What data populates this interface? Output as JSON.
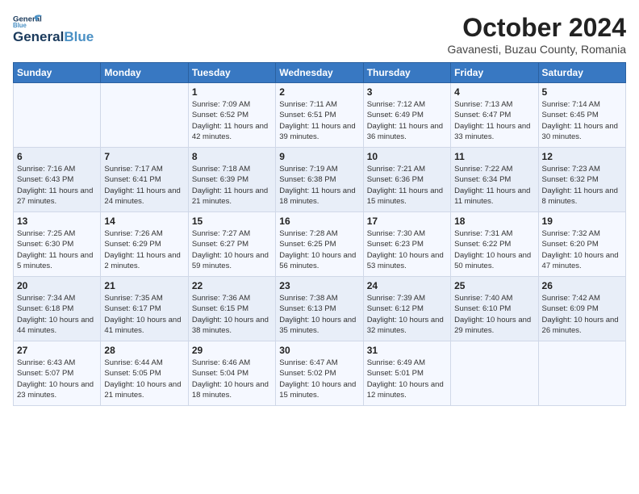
{
  "header": {
    "logo_line1": "General",
    "logo_line2": "Blue",
    "month": "October 2024",
    "location": "Gavanesti, Buzau County, Romania"
  },
  "weekdays": [
    "Sunday",
    "Monday",
    "Tuesday",
    "Wednesday",
    "Thursday",
    "Friday",
    "Saturday"
  ],
  "weeks": [
    [
      {
        "day": "",
        "info": ""
      },
      {
        "day": "",
        "info": ""
      },
      {
        "day": "1",
        "info": "Sunrise: 7:09 AM\nSunset: 6:52 PM\nDaylight: 11 hours and 42 minutes."
      },
      {
        "day": "2",
        "info": "Sunrise: 7:11 AM\nSunset: 6:51 PM\nDaylight: 11 hours and 39 minutes."
      },
      {
        "day": "3",
        "info": "Sunrise: 7:12 AM\nSunset: 6:49 PM\nDaylight: 11 hours and 36 minutes."
      },
      {
        "day": "4",
        "info": "Sunrise: 7:13 AM\nSunset: 6:47 PM\nDaylight: 11 hours and 33 minutes."
      },
      {
        "day": "5",
        "info": "Sunrise: 7:14 AM\nSunset: 6:45 PM\nDaylight: 11 hours and 30 minutes."
      }
    ],
    [
      {
        "day": "6",
        "info": "Sunrise: 7:16 AM\nSunset: 6:43 PM\nDaylight: 11 hours and 27 minutes."
      },
      {
        "day": "7",
        "info": "Sunrise: 7:17 AM\nSunset: 6:41 PM\nDaylight: 11 hours and 24 minutes."
      },
      {
        "day": "8",
        "info": "Sunrise: 7:18 AM\nSunset: 6:39 PM\nDaylight: 11 hours and 21 minutes."
      },
      {
        "day": "9",
        "info": "Sunrise: 7:19 AM\nSunset: 6:38 PM\nDaylight: 11 hours and 18 minutes."
      },
      {
        "day": "10",
        "info": "Sunrise: 7:21 AM\nSunset: 6:36 PM\nDaylight: 11 hours and 15 minutes."
      },
      {
        "day": "11",
        "info": "Sunrise: 7:22 AM\nSunset: 6:34 PM\nDaylight: 11 hours and 11 minutes."
      },
      {
        "day": "12",
        "info": "Sunrise: 7:23 AM\nSunset: 6:32 PM\nDaylight: 11 hours and 8 minutes."
      }
    ],
    [
      {
        "day": "13",
        "info": "Sunrise: 7:25 AM\nSunset: 6:30 PM\nDaylight: 11 hours and 5 minutes."
      },
      {
        "day": "14",
        "info": "Sunrise: 7:26 AM\nSunset: 6:29 PM\nDaylight: 11 hours and 2 minutes."
      },
      {
        "day": "15",
        "info": "Sunrise: 7:27 AM\nSunset: 6:27 PM\nDaylight: 10 hours and 59 minutes."
      },
      {
        "day": "16",
        "info": "Sunrise: 7:28 AM\nSunset: 6:25 PM\nDaylight: 10 hours and 56 minutes."
      },
      {
        "day": "17",
        "info": "Sunrise: 7:30 AM\nSunset: 6:23 PM\nDaylight: 10 hours and 53 minutes."
      },
      {
        "day": "18",
        "info": "Sunrise: 7:31 AM\nSunset: 6:22 PM\nDaylight: 10 hours and 50 minutes."
      },
      {
        "day": "19",
        "info": "Sunrise: 7:32 AM\nSunset: 6:20 PM\nDaylight: 10 hours and 47 minutes."
      }
    ],
    [
      {
        "day": "20",
        "info": "Sunrise: 7:34 AM\nSunset: 6:18 PM\nDaylight: 10 hours and 44 minutes."
      },
      {
        "day": "21",
        "info": "Sunrise: 7:35 AM\nSunset: 6:17 PM\nDaylight: 10 hours and 41 minutes."
      },
      {
        "day": "22",
        "info": "Sunrise: 7:36 AM\nSunset: 6:15 PM\nDaylight: 10 hours and 38 minutes."
      },
      {
        "day": "23",
        "info": "Sunrise: 7:38 AM\nSunset: 6:13 PM\nDaylight: 10 hours and 35 minutes."
      },
      {
        "day": "24",
        "info": "Sunrise: 7:39 AM\nSunset: 6:12 PM\nDaylight: 10 hours and 32 minutes."
      },
      {
        "day": "25",
        "info": "Sunrise: 7:40 AM\nSunset: 6:10 PM\nDaylight: 10 hours and 29 minutes."
      },
      {
        "day": "26",
        "info": "Sunrise: 7:42 AM\nSunset: 6:09 PM\nDaylight: 10 hours and 26 minutes."
      }
    ],
    [
      {
        "day": "27",
        "info": "Sunrise: 6:43 AM\nSunset: 5:07 PM\nDaylight: 10 hours and 23 minutes."
      },
      {
        "day": "28",
        "info": "Sunrise: 6:44 AM\nSunset: 5:05 PM\nDaylight: 10 hours and 21 minutes."
      },
      {
        "day": "29",
        "info": "Sunrise: 6:46 AM\nSunset: 5:04 PM\nDaylight: 10 hours and 18 minutes."
      },
      {
        "day": "30",
        "info": "Sunrise: 6:47 AM\nSunset: 5:02 PM\nDaylight: 10 hours and 15 minutes."
      },
      {
        "day": "31",
        "info": "Sunrise: 6:49 AM\nSunset: 5:01 PM\nDaylight: 10 hours and 12 minutes."
      },
      {
        "day": "",
        "info": ""
      },
      {
        "day": "",
        "info": ""
      }
    ]
  ]
}
